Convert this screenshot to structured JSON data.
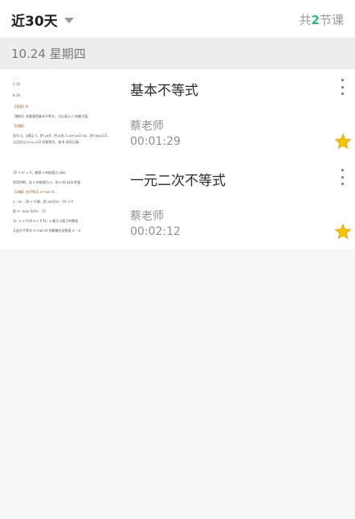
{
  "header": {
    "filter_label": "近30天",
    "count_prefix": "共",
    "count_value": "2",
    "count_suffix": "节课"
  },
  "date_bar": {
    "label": "10.24 星期四"
  },
  "lessons": [
    {
      "title": "基本不等式",
      "teacher": "蔡老师",
      "duration": "00:01:29",
      "starred": true,
      "thumb_lines": [
        "C 15",
        "B 16",
        "【答案】B",
        "【解析】选题意得基本不等式，可以表示 n 的最大值.",
        "【详解】",
        "因为 a，y满足 n，则 y≥0，所以由 1=a+y≥2√ay，即√ay≤1/2，",
        "当且仅当 a=y=1/2 时取等号，故 B 选项正确."
      ]
    },
    {
      "title": "一元二次不等式",
      "teacher": "蔡老师",
      "duration": "00:02:12",
      "starred": true,
      "thumb_lines": [
        "16 + x² = 0，解得 x 的取值为 a&b",
        "利用判断，若 x 的取值为 n，则 x 的 a&b 的值",
        "【详解】由不等式 x²+ax<0，",
        "x - ax - 10 < 0 解，即 a(a/2)x - 10 < 0",
        "即 x²- ax≤ 0/2m - 13",
        "为 - x < 0 时 a < 0 时，x 最大小值于的数值",
        "又因为不等式 x²+ax<0 的解集包含数值 x² - a"
      ],
      "thumb_hl": [
        2
      ]
    }
  ],
  "colors": {
    "accent": "#2fb67c",
    "star": "#f5c400"
  }
}
